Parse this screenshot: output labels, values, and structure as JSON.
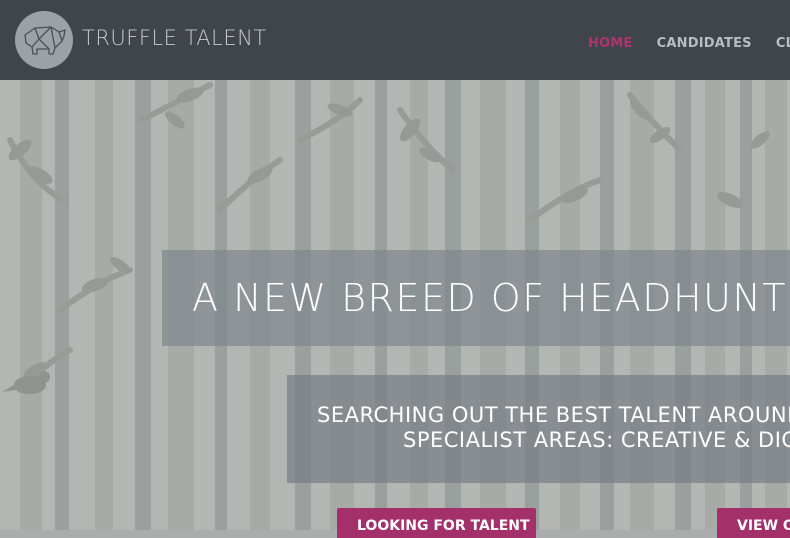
{
  "header": {
    "brand": "TRUFFLE TALENT",
    "logo_icon": "pig-icon",
    "background": "#3f454b"
  },
  "nav": {
    "items": [
      {
        "label": "HOME",
        "active": true
      },
      {
        "label": "CANDIDATES",
        "active": false
      },
      {
        "label": "CLIEN",
        "active": false
      }
    ],
    "active_color": "#b0336e"
  },
  "hero": {
    "headline": "A NEW BREED OF HEADHUNTIN",
    "sub_line_1": "SEARCHING OUT THE BEST TALENT AROUND T",
    "sub_line_2": "SPECIALIST AREAS: CREATIVE & DIGIT"
  },
  "buttons": {
    "looking": "LOOKING FOR TALENT",
    "view": "VIEW O",
    "color": "#a3306a"
  }
}
